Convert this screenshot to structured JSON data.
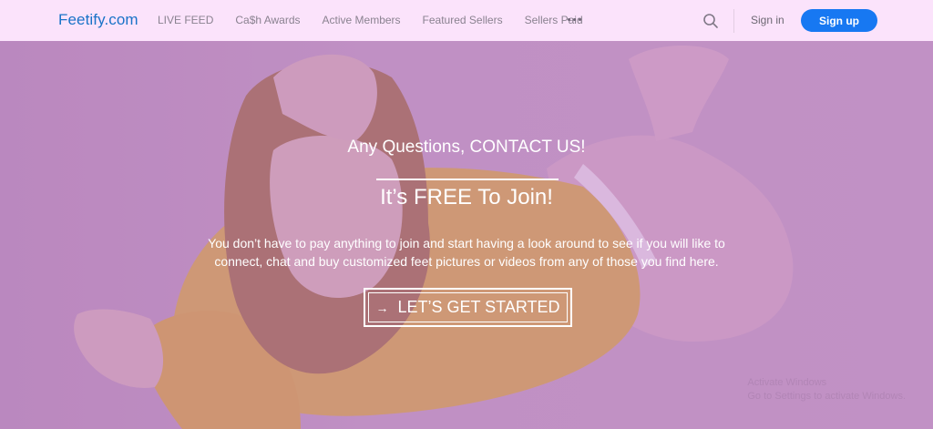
{
  "header": {
    "brand": "Feetify.com",
    "menu": [
      "LIVE FEED",
      "Ca$h Awards",
      "Active Members",
      "Featured Sellers",
      "Sellers Paid"
    ],
    "more_icon": "ellipsis-icon",
    "search_icon": "search-icon",
    "signin_label": "Sign in",
    "signup_label": "Sign up"
  },
  "hero": {
    "heading": "Any Questions, CONTACT US!",
    "title": "It’s FREE To Join!",
    "text": "You don’t have to pay anything to join and start having a look around to see if you will like to connect, chat and buy customized feet pictures or videos from any of those you find here.",
    "cta_label": "LET’S GET STARTED",
    "cta_icon": "arrow-right-icon",
    "watermark_line1": "Activate Windows",
    "watermark_line2": "Go to Settings to activate Windows."
  },
  "colors": {
    "nav_bg": "#fbe3fb",
    "brand": "#1a73c8",
    "signup_bg": "#1778f2",
    "hero_tint": "#c79bc9"
  }
}
